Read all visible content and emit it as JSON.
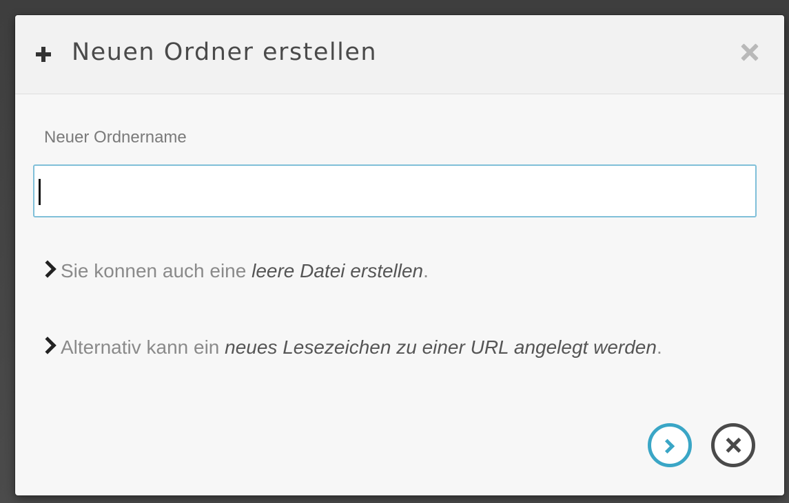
{
  "dialog": {
    "title": "Neuen Ordner erstellen",
    "field_label": "Neuer Ordnername",
    "input_value": "",
    "hint1": {
      "prefix": "Sie konnen auch eine ",
      "link": "leere Datei erstellen",
      "suffix": "."
    },
    "hint2": {
      "prefix": "Alternativ kann ein ",
      "link": "neues Lesezeichen zu einer URL angelegt werden",
      "suffix": "."
    }
  },
  "icons": {
    "title_icon": "plus-icon",
    "close_icon": "close-icon",
    "hint_icon": "chevron-right-icon",
    "confirm_icon": "chevron-right-circle-icon",
    "cancel_icon": "x-circle-icon"
  },
  "colors": {
    "accent": "#3aa6c6",
    "input_border": "#7fbfd8"
  }
}
